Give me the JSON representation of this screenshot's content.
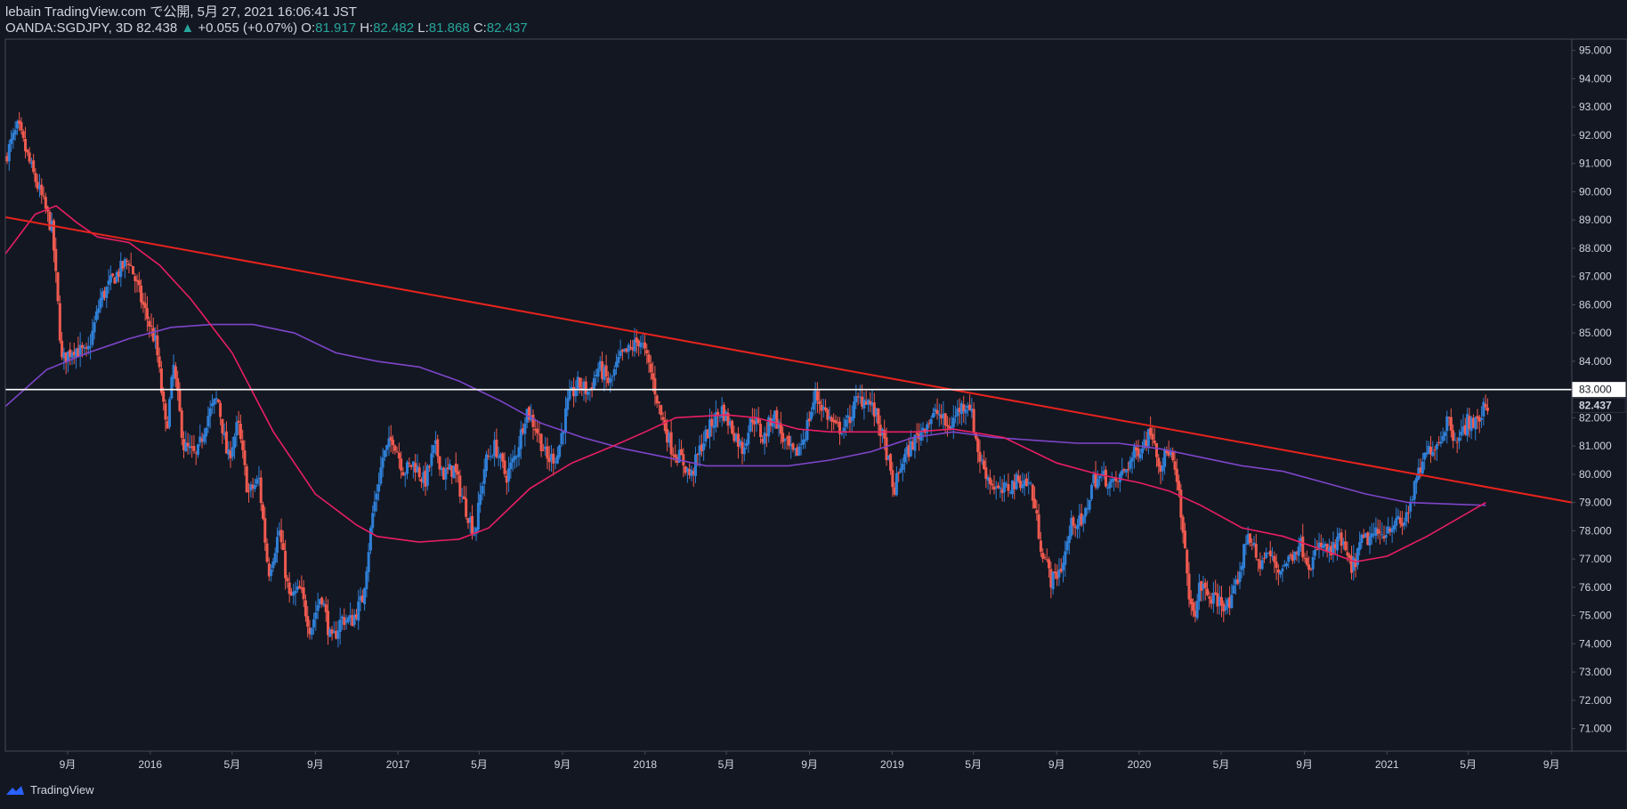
{
  "header": {
    "line1": "lebain TradingView.com で公開, 5月 27, 2021 16:06:41 JST",
    "symbol": "OANDA:SGDJPY, 3D",
    "last": "82.438",
    "arrow": "▲",
    "change": "+0.055 (+0.07%)",
    "o_label": "O:",
    "o_value": "81.917",
    "h_label": "H:",
    "h_value": "82.482",
    "l_label": "L:",
    "l_value": "81.868",
    "c_label": "C:",
    "c_value": "82.437"
  },
  "footer": {
    "brand": "TradingView",
    "logo_icon": "tradingview-logo-icon"
  },
  "colors": {
    "background": "#131722",
    "up_candle": "#2f7fd6",
    "down_candle": "#f05a4f",
    "ma_fast": "#e91e63",
    "ma_slow": "#7e45c9",
    "trendline": "#e8231d",
    "hline": "#ffffff",
    "axis_text": "#d1d4dc",
    "up_text": "#26a69a"
  },
  "chart_data": {
    "type": "candlestick",
    "title": "OANDA:SGDJPY, 3D",
    "y_axis": {
      "ylim": [
        70.2,
        95.4
      ],
      "ticks": [
        "71.000",
        "72.000",
        "73.000",
        "74.000",
        "75.000",
        "76.000",
        "77.000",
        "78.000",
        "79.000",
        "80.000",
        "81.000",
        "82.000",
        "83.000",
        "84.000",
        "85.000",
        "86.000",
        "87.000",
        "88.000",
        "89.000",
        "90.000",
        "91.000",
        "92.000",
        "93.000",
        "94.000",
        "95.000"
      ],
      "position": "right"
    },
    "x_axis": {
      "range": [
        "2015-06-01",
        "2021-10-01"
      ],
      "ticks": [
        {
          "label": "9月",
          "date": "2015-09-01"
        },
        {
          "label": "2016",
          "date": "2016-01-01"
        },
        {
          "label": "5月",
          "date": "2016-05-01"
        },
        {
          "label": "9月",
          "date": "2016-09-01"
        },
        {
          "label": "2017",
          "date": "2017-01-01"
        },
        {
          "label": "5月",
          "date": "2017-05-01"
        },
        {
          "label": "9月",
          "date": "2017-09-01"
        },
        {
          "label": "2018",
          "date": "2018-01-01"
        },
        {
          "label": "5月",
          "date": "2018-05-01"
        },
        {
          "label": "9月",
          "date": "2018-09-01"
        },
        {
          "label": "2019",
          "date": "2019-01-01"
        },
        {
          "label": "5月",
          "date": "2019-05-01"
        },
        {
          "label": "9月",
          "date": "2019-09-01"
        },
        {
          "label": "2020",
          "date": "2020-01-01"
        },
        {
          "label": "5月",
          "date": "2020-05-01"
        },
        {
          "label": "9月",
          "date": "2020-09-01"
        },
        {
          "label": "2021",
          "date": "2021-01-01"
        },
        {
          "label": "5月",
          "date": "2021-05-01"
        },
        {
          "label": "9月",
          "date": "2021-09-01"
        }
      ]
    },
    "price_path": [
      [
        "2015-06-01",
        91.2
      ],
      [
        "2015-06-20",
        92.3
      ],
      [
        "2015-07-10",
        90.8
      ],
      [
        "2015-07-25",
        89.8
      ],
      [
        "2015-08-10",
        88.6
      ],
      [
        "2015-08-24",
        84.0
      ],
      [
        "2015-09-10",
        84.5
      ],
      [
        "2015-09-30",
        84.2
      ],
      [
        "2015-10-20",
        86.2
      ],
      [
        "2015-11-10",
        87.0
      ],
      [
        "2015-12-01",
        87.6
      ],
      [
        "2015-12-20",
        86.1
      ],
      [
        "2016-01-10",
        84.6
      ],
      [
        "2016-01-25",
        81.5
      ],
      [
        "2016-02-05",
        83.8
      ],
      [
        "2016-02-20",
        81.0
      ],
      [
        "2016-03-10",
        80.6
      ],
      [
        "2016-03-25",
        82.0
      ],
      [
        "2016-04-10",
        82.7
      ],
      [
        "2016-04-25",
        80.5
      ],
      [
        "2016-05-10",
        81.8
      ],
      [
        "2016-05-25",
        79.3
      ],
      [
        "2016-06-10",
        79.8
      ],
      [
        "2016-06-24",
        76.5
      ],
      [
        "2016-07-10",
        78.0
      ],
      [
        "2016-07-25",
        75.6
      ],
      [
        "2016-08-10",
        75.9
      ],
      [
        "2016-08-25",
        74.5
      ],
      [
        "2016-09-10",
        75.8
      ],
      [
        "2016-09-25",
        74.0
      ],
      [
        "2016-10-10",
        74.9
      ],
      [
        "2016-10-25",
        74.8
      ],
      [
        "2016-11-10",
        75.6
      ],
      [
        "2016-11-25",
        78.6
      ],
      [
        "2016-12-10",
        80.6
      ],
      [
        "2016-12-25",
        81.3
      ],
      [
        "2017-01-10",
        80.1
      ],
      [
        "2017-01-25",
        80.4
      ],
      [
        "2017-02-10",
        79.7
      ],
      [
        "2017-02-25",
        81.0
      ],
      [
        "2017-03-10",
        80.0
      ],
      [
        "2017-03-25",
        80.2
      ],
      [
        "2017-04-10",
        78.9
      ],
      [
        "2017-04-25",
        77.9
      ],
      [
        "2017-05-10",
        80.4
      ],
      [
        "2017-05-25",
        81.0
      ],
      [
        "2017-06-10",
        79.9
      ],
      [
        "2017-06-25",
        80.7
      ],
      [
        "2017-07-10",
        82.3
      ],
      [
        "2017-07-25",
        81.6
      ],
      [
        "2017-08-10",
        80.5
      ],
      [
        "2017-08-25",
        80.7
      ],
      [
        "2017-09-10",
        82.6
      ],
      [
        "2017-09-25",
        83.2
      ],
      [
        "2017-10-10",
        82.9
      ],
      [
        "2017-10-25",
        83.8
      ],
      [
        "2017-11-10",
        83.2
      ],
      [
        "2017-11-25",
        84.1
      ],
      [
        "2017-12-10",
        84.4
      ],
      [
        "2017-12-25",
        84.8
      ],
      [
        "2018-01-10",
        83.6
      ],
      [
        "2018-01-25",
        82.1
      ],
      [
        "2018-02-10",
        80.9
      ],
      [
        "2018-02-25",
        80.5
      ],
      [
        "2018-03-10",
        79.9
      ],
      [
        "2018-03-25",
        81.0
      ],
      [
        "2018-04-10",
        81.8
      ],
      [
        "2018-04-25",
        82.3
      ],
      [
        "2018-05-10",
        81.6
      ],
      [
        "2018-05-25",
        80.9
      ],
      [
        "2018-06-10",
        82.1
      ],
      [
        "2018-06-25",
        81.2
      ],
      [
        "2018-07-10",
        82.2
      ],
      [
        "2018-07-25",
        81.2
      ],
      [
        "2018-08-10",
        80.6
      ],
      [
        "2018-08-25",
        81.4
      ],
      [
        "2018-09-10",
        82.8
      ],
      [
        "2018-09-25",
        82.2
      ],
      [
        "2018-10-10",
        81.6
      ],
      [
        "2018-10-25",
        81.7
      ],
      [
        "2018-11-10",
        82.6
      ],
      [
        "2018-11-25",
        82.7
      ],
      [
        "2018-12-10",
        82.0
      ],
      [
        "2018-12-25",
        80.7
      ],
      [
        "2019-01-03",
        79.3
      ],
      [
        "2019-01-15",
        80.4
      ],
      [
        "2019-02-01",
        81.1
      ],
      [
        "2019-02-20",
        81.8
      ],
      [
        "2019-03-10",
        82.2
      ],
      [
        "2019-03-25",
        81.6
      ],
      [
        "2019-04-10",
        82.3
      ],
      [
        "2019-04-25",
        82.6
      ],
      [
        "2019-05-10",
        80.6
      ],
      [
        "2019-05-25",
        79.8
      ],
      [
        "2019-06-10",
        79.3
      ],
      [
        "2019-06-25",
        79.6
      ],
      [
        "2019-07-10",
        79.8
      ],
      [
        "2019-07-25",
        79.6
      ],
      [
        "2019-08-10",
        77.4
      ],
      [
        "2019-08-25",
        76.2
      ],
      [
        "2019-09-10",
        76.8
      ],
      [
        "2019-09-25",
        78.4
      ],
      [
        "2019-10-10",
        78.2
      ],
      [
        "2019-10-25",
        79.8
      ],
      [
        "2019-11-10",
        79.9
      ],
      [
        "2019-11-25",
        79.6
      ],
      [
        "2019-12-10",
        80.1
      ],
      [
        "2019-12-25",
        80.7
      ],
      [
        "2020-01-10",
        81.2
      ],
      [
        "2020-01-20",
        81.6
      ],
      [
        "2020-02-01",
        80.3
      ],
      [
        "2020-02-15",
        80.9
      ],
      [
        "2020-02-28",
        79.4
      ],
      [
        "2020-03-10",
        76.9
      ],
      [
        "2020-03-20",
        74.8
      ],
      [
        "2020-04-01",
        76.1
      ],
      [
        "2020-04-15",
        75.6
      ],
      [
        "2020-05-01",
        75.5
      ],
      [
        "2020-05-15",
        75.3
      ],
      [
        "2020-06-01",
        76.9
      ],
      [
        "2020-06-10",
        78.0
      ],
      [
        "2020-06-25",
        76.8
      ],
      [
        "2020-07-10",
        77.2
      ],
      [
        "2020-07-25",
        76.6
      ],
      [
        "2020-08-10",
        77.0
      ],
      [
        "2020-08-25",
        77.6
      ],
      [
        "2020-09-10",
        76.8
      ],
      [
        "2020-09-25",
        77.5
      ],
      [
        "2020-10-10",
        77.2
      ],
      [
        "2020-10-25",
        77.7
      ],
      [
        "2020-11-10",
        76.6
      ],
      [
        "2020-11-25",
        77.6
      ],
      [
        "2020-12-10",
        77.8
      ],
      [
        "2020-12-25",
        77.9
      ],
      [
        "2021-01-10",
        78.3
      ],
      [
        "2021-01-25",
        78.2
      ],
      [
        "2021-02-05",
        79.0
      ],
      [
        "2021-02-20",
        80.2
      ],
      [
        "2021-03-05",
        80.9
      ],
      [
        "2021-03-20",
        81.2
      ],
      [
        "2021-04-01",
        82.0
      ],
      [
        "2021-04-10",
        81.4
      ],
      [
        "2021-04-20",
        81.3
      ],
      [
        "2021-05-01",
        81.9
      ],
      [
        "2021-05-15",
        81.8
      ],
      [
        "2021-05-27",
        82.437
      ]
    ],
    "ma_fast": [
      [
        "2015-06-01",
        87.8
      ],
      [
        "2015-07-15",
        89.2
      ],
      [
        "2015-08-15",
        89.5
      ],
      [
        "2015-09-15",
        88.9
      ],
      [
        "2015-10-15",
        88.4
      ],
      [
        "2015-12-01",
        88.2
      ],
      [
        "2016-01-15",
        87.4
      ],
      [
        "2016-03-01",
        86.2
      ],
      [
        "2016-05-01",
        84.3
      ],
      [
        "2016-07-01",
        81.5
      ],
      [
        "2016-09-01",
        79.3
      ],
      [
        "2016-11-01",
        78.2
      ],
      [
        "2016-12-01",
        77.8
      ],
      [
        "2017-02-01",
        77.6
      ],
      [
        "2017-04-01",
        77.7
      ],
      [
        "2017-05-15",
        78.1
      ],
      [
        "2017-07-15",
        79.5
      ],
      [
        "2017-09-15",
        80.4
      ],
      [
        "2017-11-15",
        81.0
      ],
      [
        "2018-01-01",
        81.5
      ],
      [
        "2018-02-15",
        82.0
      ],
      [
        "2018-05-01",
        82.1
      ],
      [
        "2018-06-15",
        82.0
      ],
      [
        "2018-08-15",
        81.6
      ],
      [
        "2018-10-01",
        81.5
      ],
      [
        "2018-12-01",
        81.5
      ],
      [
        "2019-02-01",
        81.5
      ],
      [
        "2019-04-01",
        81.6
      ],
      [
        "2019-06-15",
        81.3
      ],
      [
        "2019-09-01",
        80.4
      ],
      [
        "2019-11-01",
        80.0
      ],
      [
        "2020-01-01",
        79.7
      ],
      [
        "2020-02-15",
        79.4
      ],
      [
        "2020-04-01",
        78.9
      ],
      [
        "2020-06-01",
        78.1
      ],
      [
        "2020-08-01",
        77.8
      ],
      [
        "2020-10-01",
        77.3
      ],
      [
        "2020-11-15",
        76.9
      ],
      [
        "2021-01-01",
        77.1
      ],
      [
        "2021-03-01",
        77.8
      ],
      [
        "2021-05-27",
        79.0
      ]
    ],
    "ma_slow": [
      [
        "2015-06-01",
        82.4
      ],
      [
        "2015-08-01",
        83.7
      ],
      [
        "2015-10-01",
        84.3
      ],
      [
        "2015-12-01",
        84.8
      ],
      [
        "2016-02-01",
        85.2
      ],
      [
        "2016-04-01",
        85.3
      ],
      [
        "2016-06-01",
        85.3
      ],
      [
        "2016-08-01",
        85.0
      ],
      [
        "2016-10-01",
        84.3
      ],
      [
        "2016-12-01",
        84.0
      ],
      [
        "2017-02-01",
        83.8
      ],
      [
        "2017-04-01",
        83.3
      ],
      [
        "2017-06-01",
        82.6
      ],
      [
        "2017-08-01",
        81.8
      ],
      [
        "2017-10-01",
        81.3
      ],
      [
        "2017-12-01",
        80.9
      ],
      [
        "2018-02-01",
        80.6
      ],
      [
        "2018-04-01",
        80.3
      ],
      [
        "2018-06-01",
        80.3
      ],
      [
        "2018-08-01",
        80.3
      ],
      [
        "2018-10-01",
        80.5
      ],
      [
        "2018-12-01",
        80.8
      ],
      [
        "2019-02-01",
        81.3
      ],
      [
        "2019-04-01",
        81.5
      ],
      [
        "2019-06-01",
        81.3
      ],
      [
        "2019-08-01",
        81.2
      ],
      [
        "2019-10-01",
        81.1
      ],
      [
        "2019-12-01",
        81.1
      ],
      [
        "2020-02-01",
        80.9
      ],
      [
        "2020-04-01",
        80.6
      ],
      [
        "2020-06-01",
        80.3
      ],
      [
        "2020-08-01",
        80.1
      ],
      [
        "2020-10-01",
        79.7
      ],
      [
        "2020-12-01",
        79.3
      ],
      [
        "2021-02-01",
        79.0
      ],
      [
        "2021-05-27",
        78.9
      ]
    ],
    "trendline": {
      "start": [
        "2015-06-01",
        89.1
      ],
      "end": [
        "2021-10-01",
        79.0
      ]
    },
    "horizontal_line": 83.0,
    "price_labels": [
      {
        "value": 83.0,
        "text": "83.000",
        "style": "white"
      },
      {
        "value": 82.437,
        "text": "82.437",
        "style": "dark"
      }
    ]
  }
}
